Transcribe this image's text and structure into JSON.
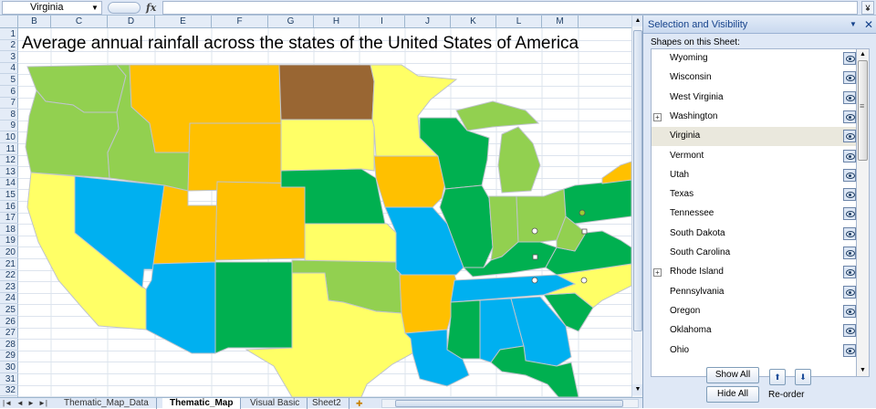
{
  "formula_bar": {
    "name_box": "Virginia",
    "formula_value": ""
  },
  "sheet": {
    "title": "Average annual rainfall across the states of the United States of America",
    "columns": [
      "B",
      "C",
      "D",
      "E",
      "F",
      "G",
      "H",
      "I",
      "J",
      "K",
      "L",
      "M"
    ],
    "rows": [
      "1",
      "2",
      "3",
      "4",
      "5",
      "6",
      "7",
      "8",
      "9",
      "10",
      "11",
      "12",
      "13",
      "14",
      "15",
      "16",
      "17",
      "18",
      "19",
      "20",
      "21",
      "22",
      "23",
      "24",
      "25",
      "26",
      "27",
      "28",
      "29",
      "30",
      "31",
      "32"
    ]
  },
  "colors": {
    "dark_green": "#00b050",
    "light_green": "#92d050",
    "yellow": "#ffff66",
    "orange": "#ffc000",
    "blue": "#00b0f0",
    "brown": "#996633"
  },
  "tabs": [
    {
      "label": "Thematic_Map_Data",
      "active": false
    },
    {
      "label": "Thematic_Map",
      "active": true
    },
    {
      "label": "Visual Basic",
      "active": false
    },
    {
      "label": "Sheet2",
      "active": false
    }
  ],
  "panel": {
    "title": "Selection and Visibility",
    "subtitle": "Shapes on this Sheet:",
    "shapes": [
      {
        "label": "Wyoming",
        "expandable": false,
        "selected": false
      },
      {
        "label": "Wisconsin",
        "expandable": false,
        "selected": false
      },
      {
        "label": "West Virginia",
        "expandable": false,
        "selected": false
      },
      {
        "label": "Washington",
        "expandable": true,
        "selected": false
      },
      {
        "label": "Virginia",
        "expandable": false,
        "selected": true
      },
      {
        "label": "Vermont",
        "expandable": false,
        "selected": false
      },
      {
        "label": "Utah",
        "expandable": false,
        "selected": false
      },
      {
        "label": "Texas",
        "expandable": false,
        "selected": false
      },
      {
        "label": "Tennessee",
        "expandable": false,
        "selected": false
      },
      {
        "label": "South Dakota",
        "expandable": false,
        "selected": false
      },
      {
        "label": "South Carolina",
        "expandable": false,
        "selected": false
      },
      {
        "label": "Rhode Island",
        "expandable": true,
        "selected": false
      },
      {
        "label": "Pennsylvania",
        "expandable": false,
        "selected": false
      },
      {
        "label": "Oregon",
        "expandable": false,
        "selected": false
      },
      {
        "label": "Oklahoma",
        "expandable": false,
        "selected": false
      },
      {
        "label": "Ohio",
        "expandable": false,
        "selected": false
      }
    ],
    "show_all_label": "Show All",
    "hide_all_label": "Hide All",
    "reorder_label": "Re-order"
  }
}
